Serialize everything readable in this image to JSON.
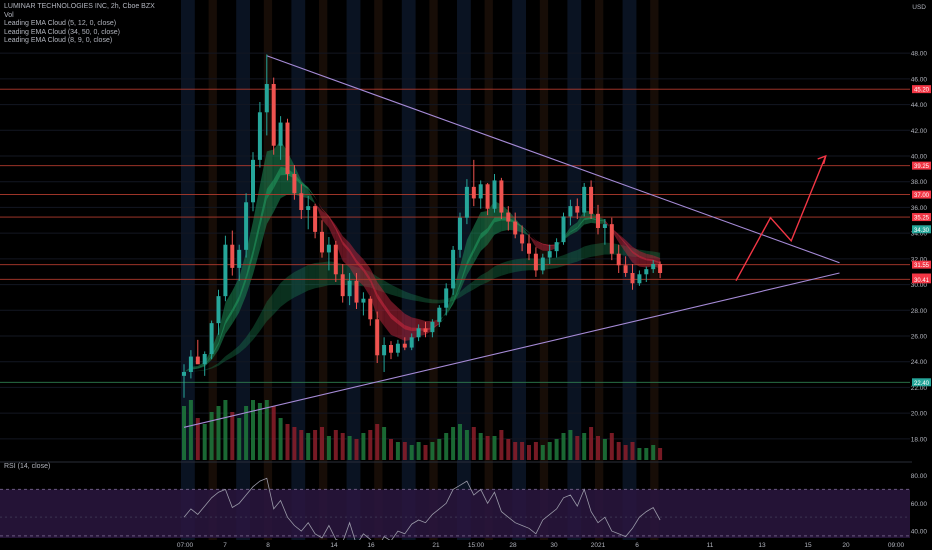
{
  "header": {
    "title": "LUMINAR TECHNOLOGIES INC, 2h, Cboe BZX",
    "indicators": [
      "Vol",
      "Leading EMA Cloud (5, 12, 0, close)",
      "Leading EMA Cloud (34, 50, 0, close)",
      "Leading EMA Cloud (8, 9, 0, close)"
    ],
    "currency": "USD"
  },
  "rsi_label": "RSI (14, close)",
  "chart_data": {
    "type": "candlestick",
    "x_ticks": [
      "07:00",
      "7",
      "8",
      "14",
      "16",
      "21",
      "15:00",
      "28",
      "30",
      "2021",
      "6",
      "11",
      "13",
      "15",
      "20",
      "09:00"
    ],
    "y_ticks": [
      48.0,
      46.0,
      44.0,
      42.0,
      40.0,
      38.0,
      36.0,
      34.0,
      32.0,
      30.0,
      28.0,
      26.0,
      24.0,
      22.0,
      20.0,
      18.0
    ],
    "ylim": [
      16.2,
      49.8
    ],
    "rsi_ticks": [
      80.0,
      60.0,
      40.0
    ],
    "rsi_lim": [
      35,
      84
    ],
    "price_tags": [
      {
        "label": "45.20",
        "value": 45.2,
        "color": "#f23645"
      },
      {
        "label": "39.25",
        "value": 39.25,
        "color": "#f23645"
      },
      {
        "label": "37.00",
        "value": 37.0,
        "color": "#f23645"
      },
      {
        "label": "35.25",
        "value": 35.25,
        "color": "#f23645"
      },
      {
        "label": "34.30",
        "value": 34.3,
        "color": "#26a69a"
      },
      {
        "label": "31.55",
        "value": 31.55,
        "color": "#f23645"
      },
      {
        "label": "30.55",
        "value": 30.55,
        "color": "#f23645"
      },
      {
        "label": "30.41",
        "value": 30.41,
        "color": "#f23645"
      },
      {
        "label": "22.40",
        "value": 22.4,
        "color": "#26a69a"
      }
    ],
    "horizontal_levels": [
      45.2,
      39.25,
      37.0,
      35.25,
      31.55,
      30.41
    ],
    "support_level": 22.4,
    "trendlines": [
      {
        "from": {
          "bar": 0,
          "price": 18.9
        },
        "to": {
          "bar": 95,
          "price": 30.9
        }
      },
      {
        "from": {
          "bar": 12,
          "price": 47.8
        },
        "to": {
          "bar": 95,
          "price": 31.7
        }
      }
    ],
    "projection_arrow": [
      {
        "bar": 80,
        "price": 30.3
      },
      {
        "bar": 85,
        "price": 35.2
      },
      {
        "bar": 88,
        "price": 33.4
      },
      {
        "bar": 93,
        "price": 40.0
      }
    ],
    "ohlc": [
      [
        22.9,
        23.8,
        21.2,
        23.2
      ],
      [
        23.2,
        24.9,
        22.7,
        24.4
      ],
      [
        24.4,
        25.7,
        23.9,
        23.8
      ],
      [
        23.8,
        24.8,
        22.9,
        24.6
      ],
      [
        24.6,
        27.2,
        24.2,
        27.0
      ],
      [
        27.0,
        29.6,
        26.1,
        29.1
      ],
      [
        29.1,
        33.8,
        28.7,
        33.1
      ],
      [
        33.1,
        34.2,
        30.7,
        31.3
      ],
      [
        31.3,
        33.1,
        30.3,
        32.7
      ],
      [
        32.7,
        37.1,
        32.1,
        36.4
      ],
      [
        36.4,
        40.3,
        35.7,
        39.7
      ],
      [
        39.7,
        44.2,
        39.1,
        43.4
      ],
      [
        43.4,
        47.9,
        41.6,
        45.6
      ],
      [
        45.6,
        46.1,
        40.1,
        40.8
      ],
      [
        40.8,
        43.1,
        39.7,
        42.6
      ],
      [
        42.6,
        42.9,
        38.1,
        38.6
      ],
      [
        38.6,
        39.3,
        36.6,
        37.1
      ],
      [
        37.1,
        37.8,
        35.1,
        35.8
      ],
      [
        35.8,
        36.9,
        34.3,
        36.1
      ],
      [
        36.1,
        36.3,
        33.6,
        34.1
      ],
      [
        34.1,
        35.0,
        32.1,
        32.5
      ],
      [
        32.5,
        33.7,
        31.1,
        33.1
      ],
      [
        33.1,
        33.4,
        30.2,
        30.8
      ],
      [
        30.8,
        31.6,
        28.6,
        29.1
      ],
      [
        29.1,
        30.9,
        28.4,
        30.3
      ],
      [
        30.3,
        30.9,
        28.1,
        28.6
      ],
      [
        28.6,
        29.4,
        27.6,
        28.9
      ],
      [
        28.9,
        29.1,
        26.8,
        27.3
      ],
      [
        27.3,
        27.9,
        23.9,
        24.5
      ],
      [
        24.5,
        25.9,
        23.2,
        25.3
      ],
      [
        25.3,
        25.6,
        24.2,
        24.7
      ],
      [
        24.7,
        25.7,
        24.4,
        25.4
      ],
      [
        25.4,
        25.9,
        24.9,
        25.1
      ],
      [
        25.1,
        26.2,
        24.9,
        25.9
      ],
      [
        25.9,
        26.9,
        25.6,
        26.6
      ],
      [
        26.6,
        27.1,
        25.9,
        26.3
      ],
      [
        26.3,
        27.3,
        25.9,
        27.1
      ],
      [
        27.1,
        28.4,
        26.7,
        28.2
      ],
      [
        28.2,
        30.1,
        27.6,
        29.7
      ],
      [
        29.7,
        33.0,
        29.2,
        32.7
      ],
      [
        32.7,
        35.6,
        32.1,
        35.2
      ],
      [
        35.2,
        38.2,
        34.7,
        37.6
      ],
      [
        37.6,
        39.7,
        36.1,
        36.7
      ],
      [
        36.7,
        38.1,
        35.9,
        37.8
      ],
      [
        37.8,
        37.9,
        35.4,
        35.9
      ],
      [
        35.9,
        38.6,
        35.6,
        38.1
      ],
      [
        38.1,
        38.3,
        35.1,
        35.6
      ],
      [
        35.6,
        36.1,
        34.2,
        34.9
      ],
      [
        34.9,
        35.6,
        33.6,
        33.9
      ],
      [
        33.9,
        34.6,
        32.6,
        33.2
      ],
      [
        33.2,
        33.9,
        31.9,
        32.4
      ],
      [
        32.4,
        32.9,
        30.6,
        31.1
      ],
      [
        31.1,
        32.4,
        30.8,
        32.1
      ],
      [
        32.1,
        33.1,
        31.6,
        32.6
      ],
      [
        32.6,
        33.6,
        32.1,
        33.3
      ],
      [
        33.3,
        35.6,
        33.1,
        35.3
      ],
      [
        35.3,
        36.6,
        34.6,
        36.1
      ],
      [
        36.1,
        36.7,
        35.1,
        35.6
      ],
      [
        35.6,
        37.9,
        35.3,
        37.6
      ],
      [
        37.6,
        38.1,
        35.1,
        35.5
      ],
      [
        35.5,
        36.2,
        33.9,
        34.4
      ],
      [
        34.4,
        35.1,
        33.1,
        34.7
      ],
      [
        34.7,
        35.2,
        31.9,
        32.4
      ],
      [
        32.4,
        33.1,
        30.9,
        31.5
      ],
      [
        31.5,
        32.2,
        30.6,
        30.9
      ],
      [
        30.9,
        31.6,
        29.6,
        30.1
      ],
      [
        30.1,
        31.1,
        29.9,
        30.8
      ],
      [
        30.8,
        31.4,
        30.2,
        31.2
      ],
      [
        31.2,
        31.9,
        30.9,
        31.6
      ],
      [
        31.6,
        31.8,
        30.5,
        30.9
      ]
    ],
    "volume": [
      0.9,
      1.0,
      0.7,
      0.6,
      0.8,
      0.9,
      1.0,
      0.8,
      0.7,
      0.9,
      1.0,
      0.95,
      1.0,
      0.9,
      0.7,
      0.6,
      0.55,
      0.5,
      0.45,
      0.5,
      0.55,
      0.4,
      0.5,
      0.45,
      0.4,
      0.35,
      0.45,
      0.5,
      0.6,
      0.55,
      0.35,
      0.3,
      0.3,
      0.25,
      0.3,
      0.25,
      0.3,
      0.35,
      0.45,
      0.55,
      0.6,
      0.5,
      0.55,
      0.45,
      0.4,
      0.4,
      0.5,
      0.35,
      0.3,
      0.3,
      0.25,
      0.3,
      0.25,
      0.3,
      0.35,
      0.45,
      0.5,
      0.4,
      0.45,
      0.55,
      0.4,
      0.35,
      0.45,
      0.3,
      0.25,
      0.3,
      0.2,
      0.2,
      0.25,
      0.2
    ],
    "rsi": [
      50,
      56,
      52,
      58,
      64,
      68,
      70,
      57,
      60,
      66,
      72,
      76,
      78,
      56,
      62,
      50,
      44,
      40,
      46,
      38,
      35,
      44,
      34,
      32,
      46,
      30,
      38,
      34,
      27,
      36,
      33,
      40,
      38,
      45,
      48,
      46,
      52,
      56,
      60,
      70,
      73,
      76,
      66,
      70,
      60,
      68,
      54,
      50,
      46,
      44,
      42,
      38,
      48,
      52,
      56,
      64,
      66,
      58,
      70,
      54,
      46,
      50,
      40,
      38,
      36,
      42,
      50,
      54,
      57,
      48
    ]
  }
}
